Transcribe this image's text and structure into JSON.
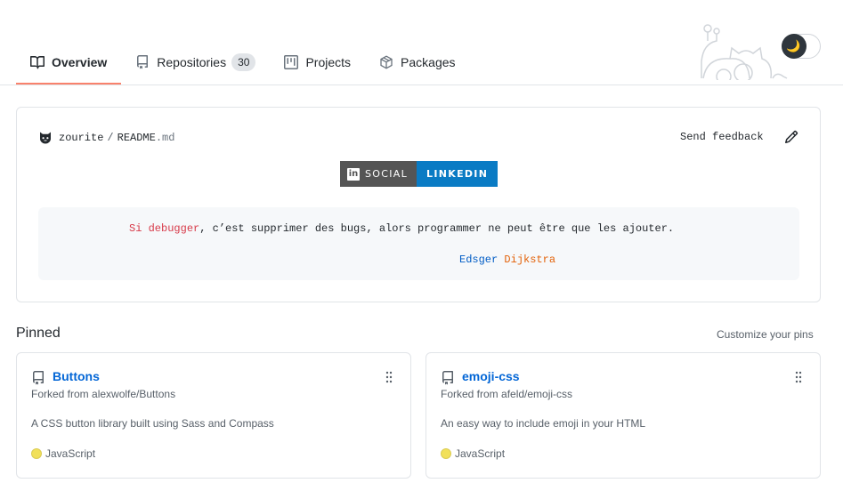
{
  "tabs": [
    {
      "label": "Overview",
      "icon": "book-icon",
      "active": true
    },
    {
      "label": "Repositories",
      "icon": "repo-icon",
      "count": "30"
    },
    {
      "label": "Projects",
      "icon": "project-icon"
    },
    {
      "label": "Packages",
      "icon": "package-icon"
    }
  ],
  "theme_toggle": {
    "icon": "moon-icon",
    "glyph": "🌙"
  },
  "readme": {
    "owner": "zourite",
    "separator": "/",
    "file_base": "README",
    "file_ext": ".md",
    "feedback": "Send feedback",
    "badge": {
      "left": "SOCIAL",
      "right": "LINKEDIN",
      "logo_text": "in"
    },
    "quote": {
      "part1": "Si",
      "part2": "debugger",
      "part3": ", c’est supprimer des bugs, alors programmer ne peut être que les ajouter.",
      "author_first": "Edsger",
      "author_last": "Dijkstra"
    }
  },
  "pinned": {
    "title": "Pinned",
    "customize": "Customize your pins",
    "cards": [
      {
        "name": "Buttons",
        "fork": "Forked from alexwolfe/Buttons",
        "description": "A CSS button library built using Sass and Compass",
        "language": "JavaScript",
        "lang_color": "#f1e05a"
      },
      {
        "name": "emoji-css",
        "fork": "Forked from afeld/emoji-css",
        "description": "An easy way to include emoji in your HTML",
        "language": "JavaScript",
        "lang_color": "#f1e05a"
      }
    ]
  },
  "colors": {
    "accent_underline": "#f9826c",
    "link": "#0366d6",
    "badge_right": "#0a7bc4"
  }
}
